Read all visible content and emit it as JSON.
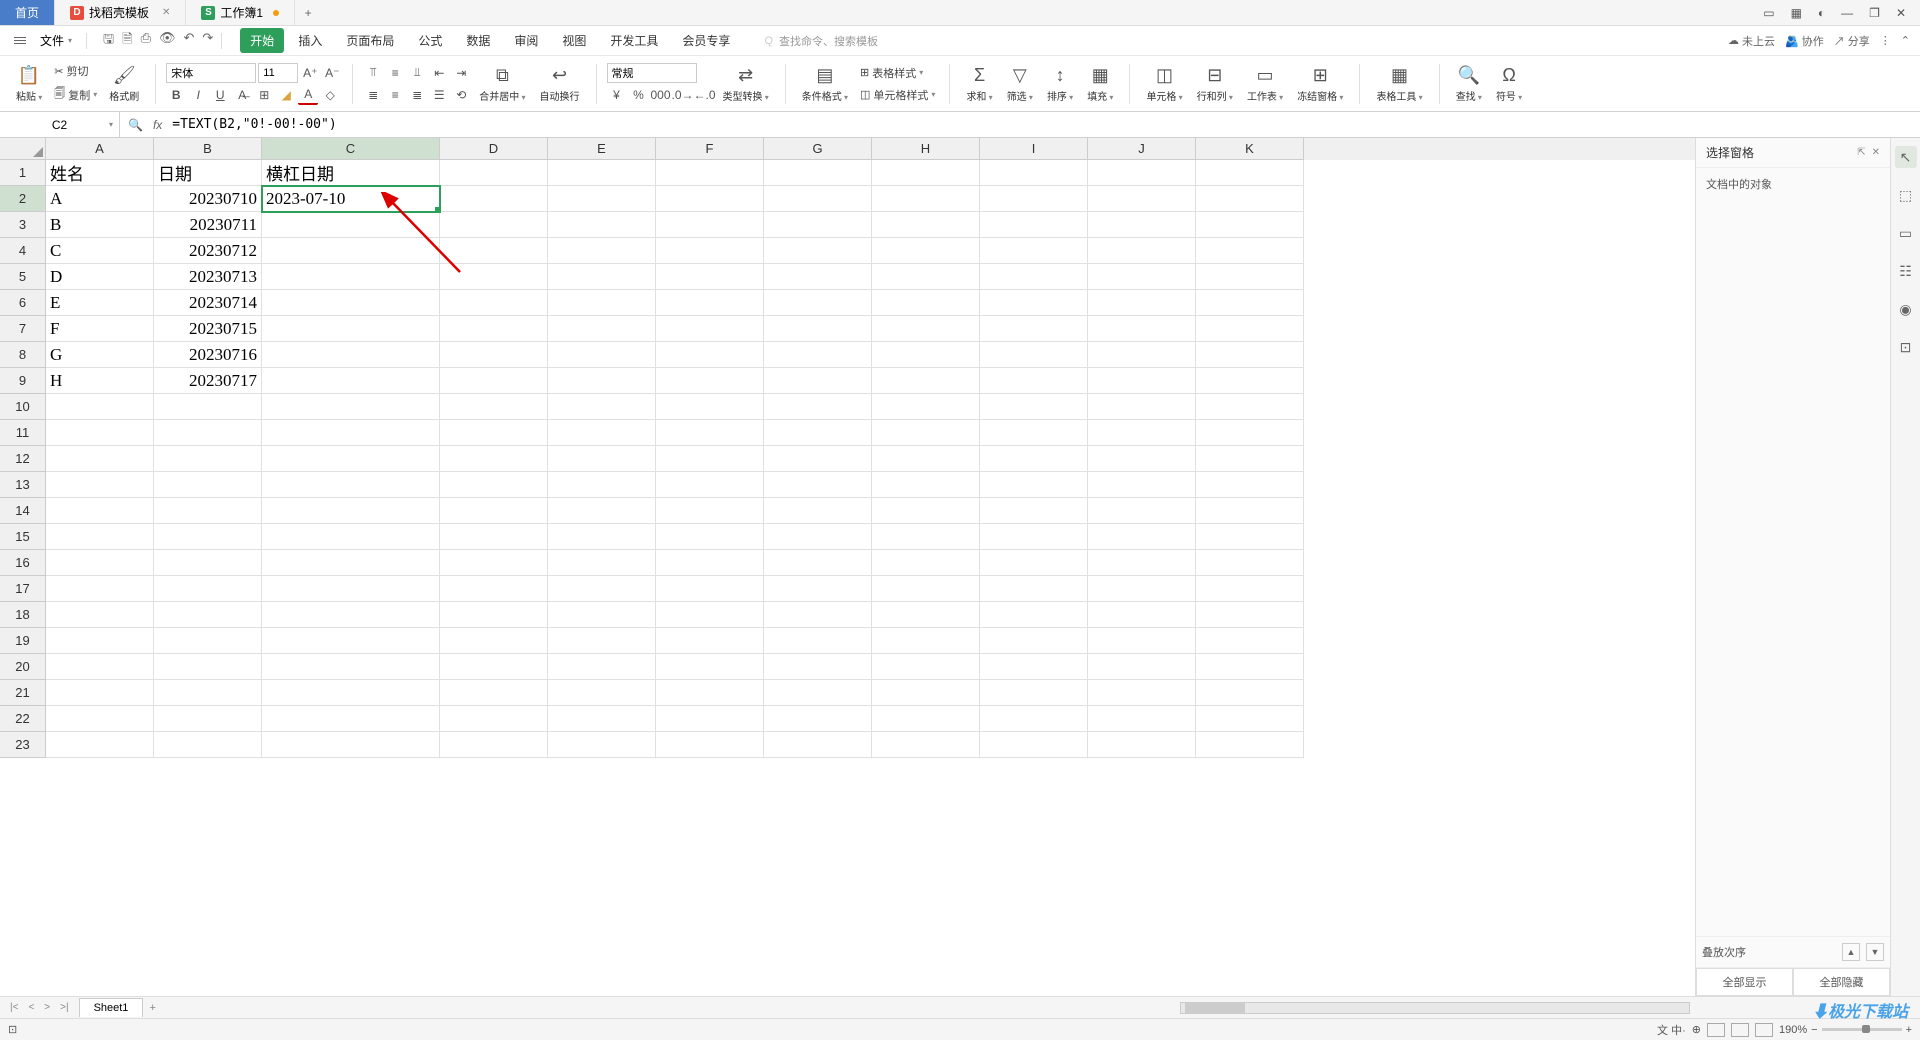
{
  "topTabs": {
    "home": "首页",
    "templates": "找稻壳模板",
    "workbook": "工作簿1"
  },
  "menuBar": {
    "file": "文件",
    "tabs": [
      "开始",
      "插入",
      "页面布局",
      "公式",
      "数据",
      "审阅",
      "视图",
      "开发工具",
      "会员专享"
    ],
    "activeTab": "开始",
    "searchPlaceholder": "查找命令、搜索模板",
    "searchIcon": "Q",
    "cloud": "未上云",
    "coop": "协作",
    "share": "分享"
  },
  "ribbon": {
    "paste": "粘贴",
    "cut": "剪切",
    "copy": "复制",
    "formatPainter": "格式刷",
    "fontName": "宋体",
    "fontSize": "11",
    "mergeCenter": "合并居中",
    "wrapText": "自动换行",
    "numberFormat": "常规",
    "typeConvert": "类型转换",
    "condFormat": "条件格式",
    "tableStyle": "表格样式",
    "cellStyle": "单元格样式",
    "sum": "求和",
    "filter": "筛选",
    "sort": "排序",
    "fill": "填充",
    "cells": "单元格",
    "rowCol": "行和列",
    "worksheet": "工作表",
    "freezePane": "冻结窗格",
    "tableTools": "表格工具",
    "find": "查找",
    "symbol": "符号"
  },
  "formulaBar": {
    "nameBox": "C2",
    "formula": "=TEXT(B2,\"0!-00!-00\")"
  },
  "columns": [
    "A",
    "B",
    "C",
    "D",
    "E",
    "F",
    "G",
    "H",
    "I",
    "J",
    "K"
  ],
  "rowCount": 23,
  "activeCell": {
    "row": 2,
    "col": "C"
  },
  "data": {
    "headers": {
      "A": "姓名",
      "B": "日期",
      "C": "横杠日期"
    },
    "rows": [
      {
        "A": "A",
        "B": "20230710",
        "C": "2023-07-10"
      },
      {
        "A": "B",
        "B": "20230711",
        "C": ""
      },
      {
        "A": "C",
        "B": "20230712",
        "C": ""
      },
      {
        "A": "D",
        "B": "20230713",
        "C": ""
      },
      {
        "A": "E",
        "B": "20230714",
        "C": ""
      },
      {
        "A": "F",
        "B": "20230715",
        "C": ""
      },
      {
        "A": "G",
        "B": "20230716",
        "C": ""
      },
      {
        "A": "H",
        "B": "20230717",
        "C": ""
      }
    ]
  },
  "sidePanel": {
    "title": "选择窗格",
    "subtitle": "文档中的对象",
    "order": "叠放次序",
    "showAll": "全部显示",
    "hideAll": "全部隐藏"
  },
  "sheetTabs": {
    "sheet1": "Sheet1"
  },
  "statusBar": {
    "zoomValue": "190%"
  },
  "watermark": {
    "main": "极光下载站",
    "icon": "⬇"
  }
}
